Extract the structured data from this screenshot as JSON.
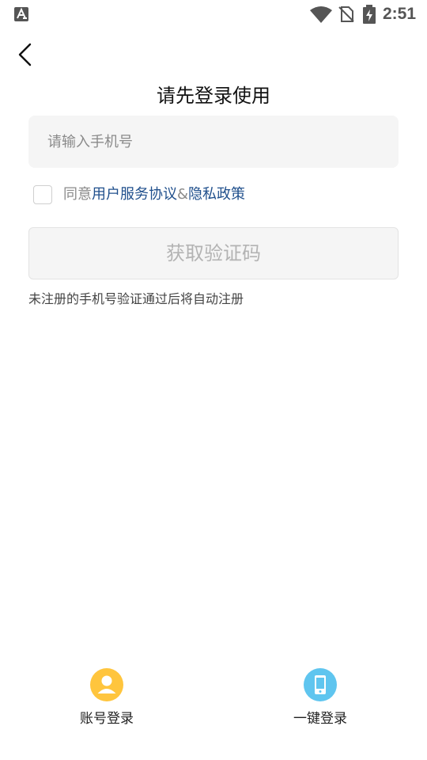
{
  "status_bar": {
    "app_icon": "a-letter-icon",
    "wifi_icon": "wifi-icon",
    "sim_icon": "no-sim-icon",
    "battery_icon": "battery-charging-icon",
    "time": "2:51"
  },
  "header": {
    "back_icon": "chevron-left-icon",
    "title": "请先登录使用"
  },
  "form": {
    "phone_placeholder": "请输入手机号",
    "phone_value": "",
    "agreement": {
      "checked": false,
      "prefix": "同意",
      "service_link": "用户服务协议",
      "separator": "&",
      "privacy_link": "隐私政策"
    },
    "get_code_label": "获取验证码",
    "hint": "未注册的手机号验证通过后将自动注册"
  },
  "alt_login": {
    "account": {
      "label": "账号登录",
      "icon": "user-icon",
      "color": "#ffc53d"
    },
    "onekey": {
      "label": "一键登录",
      "icon": "phone-icon",
      "color": "#5fc5ef"
    }
  },
  "colors": {
    "link": "#1f4f8c",
    "input_bg": "#f5f5f5",
    "button_text": "#b3b3b3"
  }
}
